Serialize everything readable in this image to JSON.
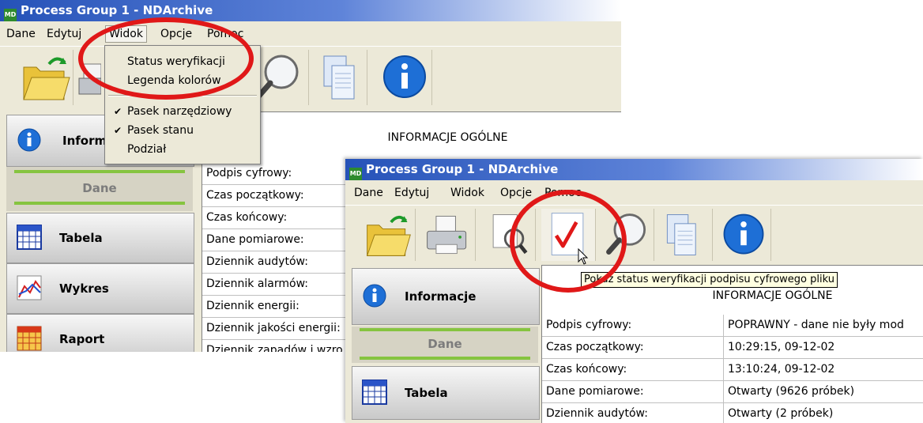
{
  "window1": {
    "title": "Process Group 1 - NDArchive",
    "menu": [
      "Dane",
      "Edytuj",
      "Widok",
      "Opcje",
      "Pomoc"
    ],
    "dropdown": {
      "items": [
        "Status weryfikacji",
        "Legenda kolorów"
      ],
      "checked_items": [
        "Pasek narzędziowy",
        "Pasek stanu"
      ],
      "last_item": "Podział",
      "check_glyph": "✔"
    },
    "sidebar": {
      "info_label": "Inform",
      "section_label": "Dane",
      "buttons": [
        "Tabela",
        "Wykres",
        "Raport"
      ]
    },
    "info_header": "INFORMACJE OGÓLNE",
    "rows": [
      "Podpis cyfrowy:",
      "Czas początkowy:",
      "Czas końcowy:",
      "Dane pomiarowe:",
      "Dziennik audytów:",
      "Dziennik alarmów:",
      "Dziennik energii:",
      "Dziennik jakości energii:",
      "Dziennik zapadów i wzro"
    ]
  },
  "window2": {
    "title": "Process Group 1 - NDArchive",
    "menu": [
      "Dane",
      "Edytuj",
      "Widok",
      "Opcje",
      "Pomoc"
    ],
    "tooltip": "Pokaż status weryfikacji podpisu cyfrowego pliku",
    "sidebar": {
      "info_label": "Informacje",
      "section_label": "Dane",
      "buttons": [
        "Tabela"
      ]
    },
    "info_header": "INFORMACJE OGÓLNE",
    "rows": [
      {
        "key": "Podpis cyfrowy:",
        "value": "POPRAWNY - dane nie były mod"
      },
      {
        "key": "Czas początkowy:",
        "value": "10:29:15, 09-12-02"
      },
      {
        "key": "Czas końcowy:",
        "value": "13:10:24, 09-12-02"
      },
      {
        "key": "Dane pomiarowe:",
        "value": "Otwarty (9626 próbek)"
      },
      {
        "key": "Dziennik audytów:",
        "value": "Otwarty (2 próbek)"
      }
    ]
  },
  "icons": [
    "folder-open-icon",
    "printer-icon",
    "magnifier-icon",
    "checkmark-icon",
    "documents-icon",
    "info-icon",
    "table-icon",
    "chart-icon",
    "report-icon"
  ],
  "colors": {
    "titlebar": "#2552b8",
    "highlight_ring": "#e01818",
    "green_bar": "#86c440",
    "tooltip_bg": "#ffffe1"
  }
}
